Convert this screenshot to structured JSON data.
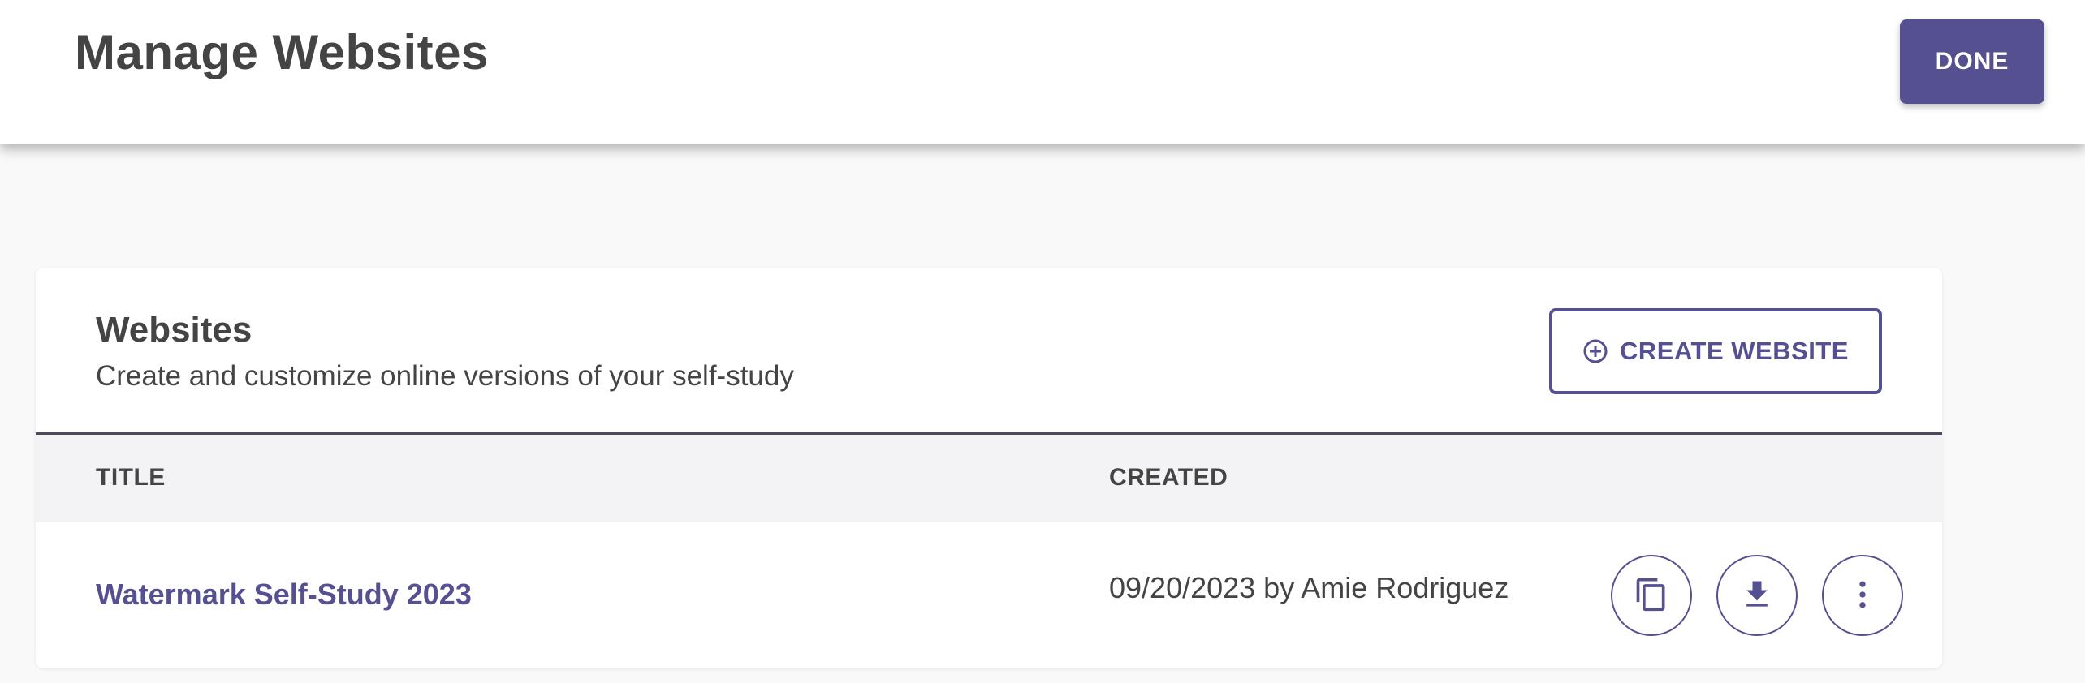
{
  "header": {
    "title": "Manage Websites",
    "done_label": "DONE"
  },
  "card": {
    "title": "Websites",
    "subtitle": "Create and customize online versions of your self-study",
    "create_label": "CREATE WEBSITE"
  },
  "table": {
    "columns": [
      "TITLE",
      "CREATED"
    ],
    "rows": [
      {
        "title": "Watermark Self-Study 2023",
        "created": "09/20/2023 by Amie Rodriguez"
      }
    ]
  },
  "icons": {
    "create": "plus-circle-icon",
    "copy": "copy-icon",
    "download": "download-icon",
    "more": "more-vertical-icon"
  },
  "colors": {
    "accent": "#55508f",
    "text": "#444444",
    "table_header_bg": "#f3f3f5",
    "page_bg": "#f9f9f9"
  }
}
